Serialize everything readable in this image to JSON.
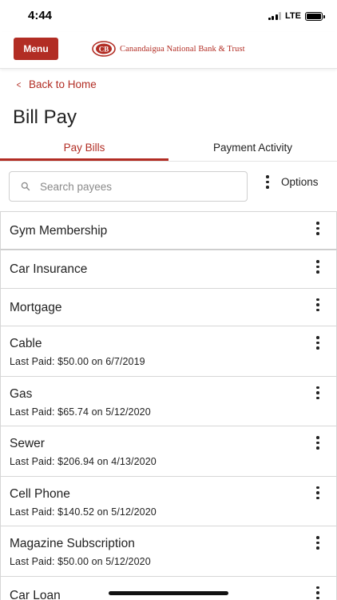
{
  "status_bar": {
    "time": "4:44",
    "network": "LTE",
    "signal_bars_filled": 3,
    "signal_bars_total": 4
  },
  "header": {
    "menu_label": "Menu",
    "bank_name": "Canandaigua National Bank & Trust",
    "brand_color": "#b22d24"
  },
  "nav": {
    "back_label": "Back to Home",
    "back_icon": "chevron-left-icon"
  },
  "page": {
    "title": "Bill Pay"
  },
  "tabs": [
    {
      "label": "Pay Bills",
      "active": true
    },
    {
      "label": "Payment Activity",
      "active": false
    }
  ],
  "search": {
    "placeholder": "Search payees",
    "value": "",
    "icon": "search-icon"
  },
  "options": {
    "label": "Options",
    "icon": "more-vertical-icon"
  },
  "payees": [
    {
      "name": "Gym Membership",
      "last_paid": ""
    },
    {
      "name": "Car Insurance",
      "last_paid": ""
    },
    {
      "name": "Mortgage",
      "last_paid": ""
    },
    {
      "name": "Cable",
      "last_paid": "Last Paid: $50.00 on 6/7/2019"
    },
    {
      "name": "Gas",
      "last_paid": "Last Paid: $65.74 on 5/12/2020"
    },
    {
      "name": "Sewer",
      "last_paid": "Last Paid: $206.94 on 4/13/2020"
    },
    {
      "name": "Cell Phone",
      "last_paid": "Last Paid: $140.52 on 5/12/2020"
    },
    {
      "name": "Magazine Subscription",
      "last_paid": "Last Paid: $50.00 on 5/12/2020"
    },
    {
      "name": "Car Loan",
      "last_paid": ""
    }
  ]
}
